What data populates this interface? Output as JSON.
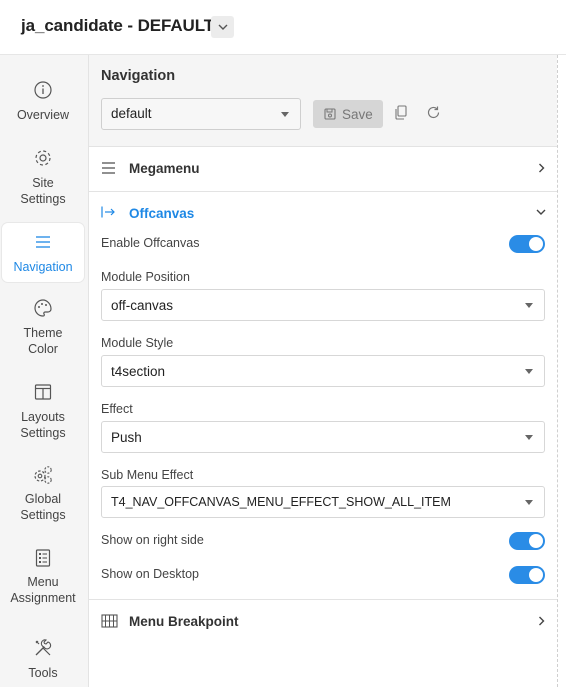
{
  "app": {
    "title": "ja_candidate - DEFAULT"
  },
  "sidebar": {
    "items": [
      {
        "label_line1": "Overview",
        "label_line2": "",
        "icon": "info-icon",
        "active": false
      },
      {
        "label_line1": "Site",
        "label_line2": "Settings",
        "icon": "gear-icon",
        "active": false
      },
      {
        "label_line1": "Navigation",
        "label_line2": "",
        "icon": "menu-lines-icon",
        "active": true
      },
      {
        "label_line1": "Theme",
        "label_line2": "Color",
        "icon": "palette-icon",
        "active": false
      },
      {
        "label_line1": "Layouts",
        "label_line2": "Settings",
        "icon": "layout-columns-icon",
        "active": false
      },
      {
        "label_line1": "Global",
        "label_line2": "Settings",
        "icon": "gears-icon",
        "active": false
      },
      {
        "label_line1": "Menu",
        "label_line2": "Assignment",
        "icon": "list-doc-icon",
        "active": false
      },
      {
        "label_line1": "Tools",
        "label_line2": "",
        "icon": "tools-icon",
        "active": false
      }
    ]
  },
  "navigation": {
    "title": "Navigation",
    "preset_value": "default",
    "save_label": "Save"
  },
  "sections": {
    "megamenu": {
      "label": "Megamenu"
    },
    "offcanvas": {
      "label": "Offcanvas",
      "accent": "#1e88e5",
      "enable_label": "Enable Offcanvas",
      "enable_on": true,
      "module_position_label": "Module Position",
      "module_position_value": "off-canvas",
      "module_style_label": "Module Style",
      "module_style_value": "t4section",
      "effect_label": "Effect",
      "effect_value": "Push",
      "sub_menu_effect_label": "Sub Menu Effect",
      "sub_menu_effect_value": "T4_NAV_OFFCANVAS_MENU_EFFECT_SHOW_ALL_ITEM",
      "right_side_label": "Show on right side",
      "right_side_on": true,
      "desktop_label": "Show on Desktop",
      "desktop_on": true
    },
    "breakpoint": {
      "label": "Menu Breakpoint"
    }
  },
  "colors": {
    "toggle_on": "#2a8ce6",
    "active_text": "#1e88e5"
  }
}
